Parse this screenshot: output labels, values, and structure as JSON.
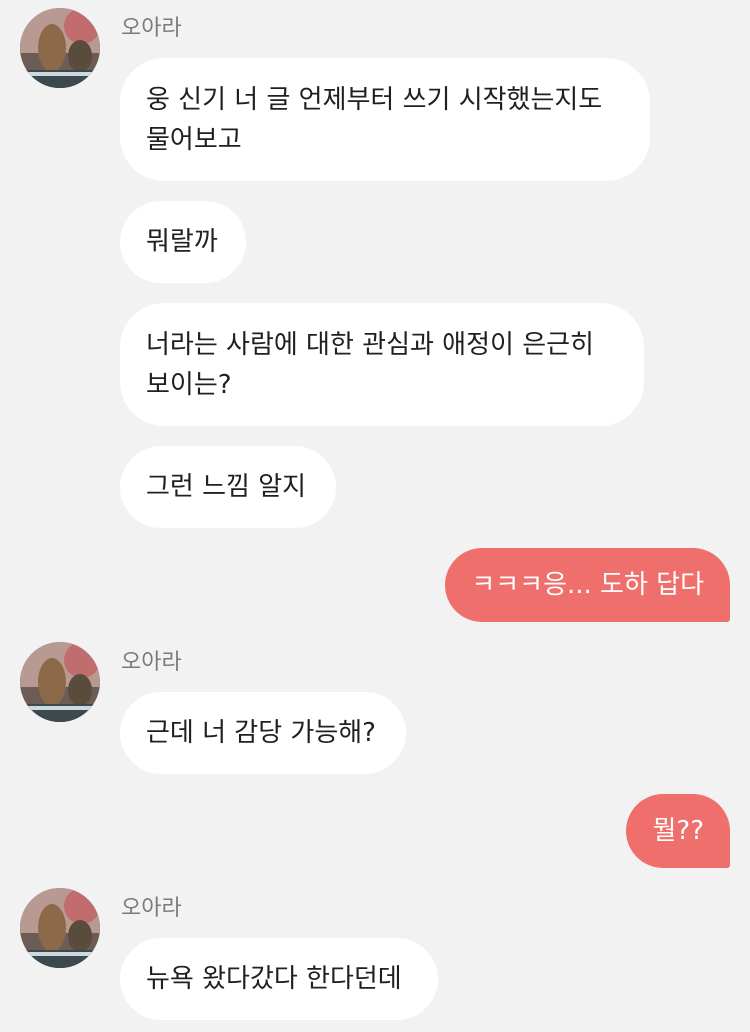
{
  "colors": {
    "background": "#f2f2f2",
    "incoming_bubble": "#ffffff",
    "outgoing_bubble": "#ef6f6d",
    "sender_name": "#7b7b7b"
  },
  "chat": {
    "groups": [
      {
        "sender": "오아라",
        "messages": [
          [
            "웅 신기 너 글 언제부터 쓰기 시작했는지도",
            "물어보고"
          ],
          [
            "뭐랄까"
          ],
          [
            "너라는 사람에 대한 관심과 애정이 은근히",
            "보이는?"
          ],
          [
            "그런 느낌 알지"
          ]
        ]
      },
      {
        "outgoing": "ㅋㅋㅋ응... 도하 답다"
      },
      {
        "sender": "오아라",
        "messages": [
          [
            "근데 너 감당 가능해?"
          ]
        ]
      },
      {
        "outgoing": "뭘??"
      },
      {
        "sender": "오아라",
        "messages": [
          [
            "뉴욕 왔다갔다 한다던데"
          ]
        ]
      }
    ]
  }
}
